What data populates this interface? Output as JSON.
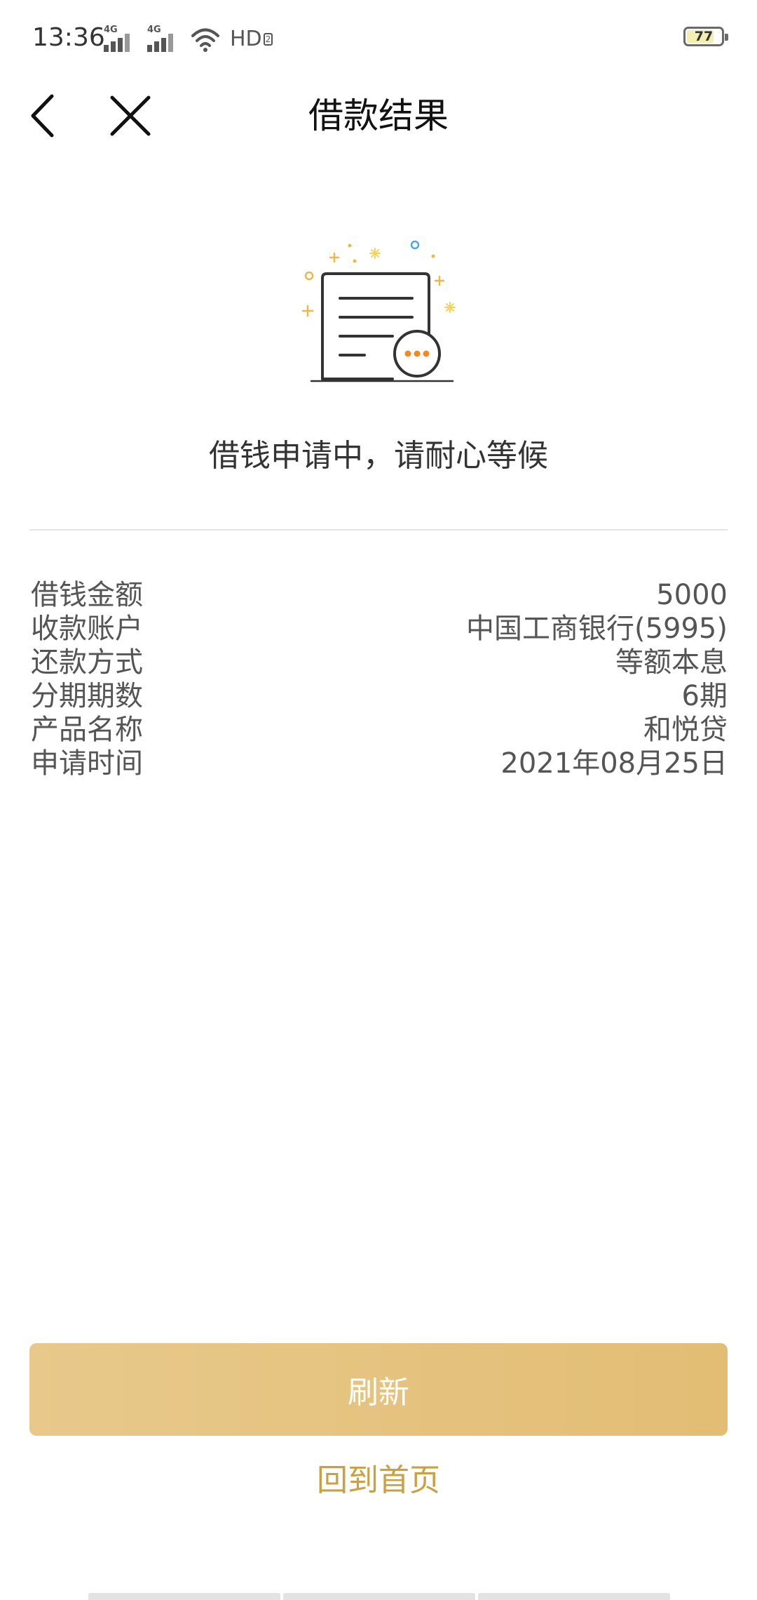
{
  "status_bar": {
    "time": "13:36",
    "network_1": "4G",
    "network_2": "4G",
    "hd": "HD",
    "hd_sub": "2",
    "battery": "77",
    "battery_level": 0.77
  },
  "nav": {
    "title": "借款结果",
    "back_icon": "chevron-left-icon",
    "close_icon": "close-icon"
  },
  "illustration": {
    "icon": "document-pending-icon",
    "accent_color": "#f08a24",
    "line_color": "#333333"
  },
  "status_message": "借钱申请中，请耐心等候",
  "details": [
    {
      "label": "借钱金额",
      "value": "5000"
    },
    {
      "label": "收款账户",
      "value": "中国工商银行(5995)"
    },
    {
      "label": "还款方式",
      "value": "等额本息"
    },
    {
      "label": "分期期数",
      "value": "6期"
    },
    {
      "label": "产品名称",
      "value": "和悦贷"
    },
    {
      "label": "申请时间",
      "value": "2021年08月25日"
    }
  ],
  "actions": {
    "refresh_label": "刷新",
    "home_label": "回到首页"
  },
  "colors": {
    "button_gold": "#e5c17e",
    "link_gold": "#c9a143"
  }
}
